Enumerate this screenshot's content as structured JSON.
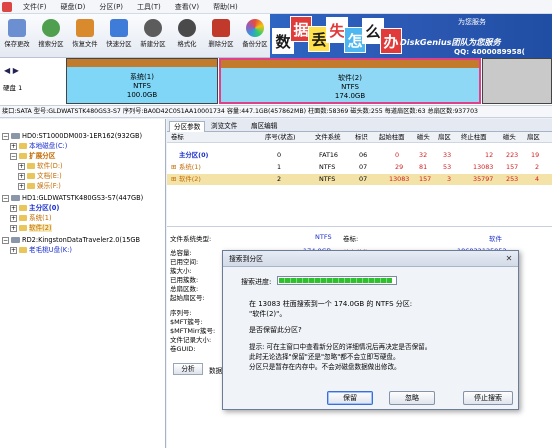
{
  "menu": {
    "items": [
      "文件(F)",
      "硬盘(D)",
      "分区(P)",
      "工具(T)",
      "查看(V)",
      "帮助(H)"
    ]
  },
  "toolbar": {
    "buttons": [
      {
        "label": "保存更改",
        "icon": "save-icon",
        "color": "#6b8fd1"
      },
      {
        "label": "搜索分区",
        "icon": "search-icon",
        "color": "#4f9f4f"
      },
      {
        "label": "恢复文件",
        "icon": "recover-icon",
        "color": "#d88a2c"
      },
      {
        "label": "快速分区",
        "icon": "quick-partition-icon",
        "color": "#3f7bd8"
      },
      {
        "label": "新建分区",
        "icon": "new-partition-icon",
        "color": "#5c5c5c"
      },
      {
        "label": "格式化",
        "icon": "format-icon",
        "color": "#4a4a4a"
      },
      {
        "label": "删除分区",
        "icon": "delete-icon",
        "color": "#c0392b"
      },
      {
        "label": "备份分区",
        "icon": "backup-icon",
        "color": "#8e44ad"
      }
    ]
  },
  "banner": {
    "chars": [
      "数",
      "据",
      "丢",
      "失",
      "怎",
      "么",
      "办"
    ],
    "brand": "DiskGenius团队为您服务",
    "qq": "QQ: 4000089958(",
    "topline": "为您服务"
  },
  "disk_bar": {
    "nav": "◀ ▶",
    "disk_label": "硬盘 1",
    "segments": [
      {
        "name": "系统(1)",
        "fs": "NTFS",
        "size": "100.0GB"
      },
      {
        "name": "软件(2)",
        "fs": "NTFS",
        "size": "174.0GB"
      }
    ]
  },
  "info_line": "接口:SATA  型号:GLDWATSTK480GS3-S7  序列号:BA0D42C0S1AA10001734  容量:447.1GB(457862MB)  柱面数:58369  磁头数:255  每道扇区数:63  总扇区数:937703",
  "tree": {
    "hd0": "HD0:ST1000DM003-1ER162(932GB)",
    "hd0_items": [
      "本地磁盘(C:)",
      "扩展分区",
      "软件(D:)",
      "文档(E:)",
      "娱乐(F:)"
    ],
    "hd1": "HD1:GLDWATSTK480GS3-S7(447GB)",
    "hd1_items": [
      "主分区(0)",
      "系统(1)",
      "软件(2)"
    ],
    "rd2": "RD2:KingstonDataTraveler2.0(15GB",
    "rd2_items": [
      "老毛桃U盘(K:)"
    ]
  },
  "tabs": [
    "分区参数",
    "浏览文件",
    "扇区编辑"
  ],
  "grid": {
    "headers": [
      "卷标",
      "序号(状态)",
      "文件系统",
      "标识",
      "起始柱面",
      "磁头",
      "扇区",
      "终止柱面",
      "磁头",
      "扇区"
    ],
    "rows": [
      {
        "name": "主分区(0)",
        "index": "0",
        "fs": "FAT16",
        "id": "06",
        "start_cyl": "0",
        "start_head": "32",
        "start_sec": "33",
        "end_cyl": "12",
        "end_head": "223",
        "end_sec": "19"
      },
      {
        "name": "系统(1)",
        "index": "1",
        "fs": "NTFS",
        "id": "07",
        "start_cyl": "29",
        "start_head": "81",
        "start_sec": "53",
        "end_cyl": "13083",
        "end_head": "157",
        "end_sec": "2"
      },
      {
        "name": "软件(2)",
        "index": "2",
        "fs": "NTFS",
        "id": "07",
        "start_cyl": "13083",
        "start_head": "157",
        "start_sec": "3",
        "end_cyl": "35797",
        "end_head": "253",
        "end_sec": "4"
      }
    ]
  },
  "details": {
    "fs_type_label": "文件系统类型:",
    "fs_type_value": "NTFS",
    "vol_label_label": "卷标:",
    "vol_label_value": "软件",
    "total_cap_label": "总容量:",
    "total_cap_value": "174.0GB",
    "total_bytes_label": "总字节数:",
    "total_bytes_value": "186832125952",
    "fields": [
      "已用空间:",
      "簇大小:",
      "已用簇数:",
      "总扇区数:",
      "起始扇区号:",
      "",
      "序列号:",
      "$MFT簇号:",
      "$MFTMirr簇号:",
      "文件记录大小:",
      "卷GUID:"
    ],
    "button": "分析",
    "button_label": "数据"
  },
  "dialog": {
    "title": "搜索到分区",
    "progress_label": "搜索进度:",
    "progress": 0.97,
    "line1": "在 13083 柱面搜索到一个 174.0GB 的 NTFS 分区:",
    "line2": "\"软件(2)\"。",
    "question": "是否保留此分区?",
    "note1": "提示: 可在主窗口中查看新分区的详细情况后再决定是否保留。",
    "note2": "此时无论选择\"保留\"还是\"忽略\"都不会立即写硬盘。",
    "note3": "分区只是暂存在内存中。不会对磁盘数据做出修改。",
    "keep": "保留",
    "ignore": "忽略",
    "stop": "停止搜索"
  }
}
